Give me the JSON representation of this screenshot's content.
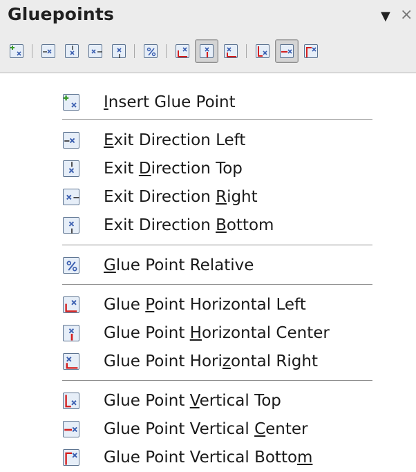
{
  "toolbar": {
    "title": "Gluepoints",
    "menu_arrow": "▼",
    "close_symbol": "×"
  },
  "legend": {
    "items": [
      {
        "before": "",
        "u": "I",
        "after": "nsert Glue Point",
        "icon": "insert-glue-point-icon"
      },
      {
        "before": "",
        "u": "E",
        "after": "xit Direction Left",
        "icon": "exit-direction-left-icon"
      },
      {
        "before": "Exit ",
        "u": "D",
        "after": "irection Top",
        "icon": "exit-direction-top-icon"
      },
      {
        "before": "Exit Direction ",
        "u": "R",
        "after": "ight",
        "icon": "exit-direction-right-icon"
      },
      {
        "before": "Exit Direction ",
        "u": "B",
        "after": "ottom",
        "icon": "exit-direction-bottom-icon"
      },
      {
        "before": "",
        "u": "G",
        "after": "lue Point Relative",
        "icon": "glue-point-relative-icon"
      },
      {
        "before": "Glue ",
        "u": "P",
        "after": "oint Horizontal Left",
        "icon": "horizontal-left-icon"
      },
      {
        "before": "Glue Point ",
        "u": "H",
        "after": "orizontal Center",
        "icon": "horizontal-center-icon"
      },
      {
        "before": "Glue Point Hori",
        "u": "z",
        "after": "ontal Right",
        "icon": "horizontal-right-icon"
      },
      {
        "before": "Glue Point ",
        "u": "V",
        "after": "ertical Top",
        "icon": "vertical-top-icon"
      },
      {
        "before": "Glue Point Vertical ",
        "u": "C",
        "after": "enter",
        "icon": "vertical-center-icon"
      },
      {
        "before": "Glue Point Vertical Botto",
        "u": "m",
        "after": "",
        "icon": "vertical-bottom-icon"
      }
    ]
  },
  "colors": {
    "accent_red": "#d42020",
    "accent_green": "#3a9a2a",
    "icon_blue": "#3b5fb0",
    "icon_frame": "#5c7390",
    "icon_fill": "#e6eef8"
  }
}
